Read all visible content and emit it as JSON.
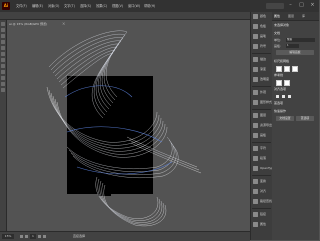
{
  "app": {
    "logo": "Ai"
  },
  "menu": [
    "文件(F)",
    "编辑(E)",
    "对象(O)",
    "文字(T)",
    "选择(S)",
    "效果(C)",
    "视图(V)",
    "窗口(W)",
    "帮助(H)"
  ],
  "document_tab": {
    "title": "ai @ 15% (RGB/GPU 预览)",
    "close": "×"
  },
  "status": {
    "zoom": "15%",
    "page": "1",
    "tool_text": "直接选择"
  },
  "panels": [
    {
      "label": "颜色",
      "icon": "color-icon"
    },
    {
      "label": "色板",
      "icon": "swatches-icon"
    },
    {
      "label": "画笔",
      "icon": "brushes-icon"
    },
    {
      "label": "符号",
      "icon": "symbols-icon"
    },
    {
      "label": "描边",
      "icon": "stroke-icon"
    },
    {
      "label": "渐变",
      "icon": "gradient-icon"
    },
    {
      "label": "透明度",
      "icon": "transparency-icon"
    },
    {
      "label": "外观",
      "icon": "appearance-icon"
    },
    {
      "label": "图形样式",
      "icon": "graphic-styles-icon"
    },
    {
      "label": "图层",
      "icon": "layers-icon"
    },
    {
      "label": "资源导出",
      "icon": "asset-export-icon"
    },
    {
      "label": "画板",
      "icon": "artboards-icon"
    },
    {
      "label": "字符",
      "icon": "character-icon"
    },
    {
      "label": "段落",
      "icon": "paragraph-icon"
    },
    {
      "label": "OpenType",
      "icon": "opentype-icon"
    },
    {
      "label": "变换",
      "icon": "transform-icon"
    },
    {
      "label": "对齐",
      "icon": "align-icon"
    },
    {
      "label": "路径查找器",
      "icon": "pathfinder-icon"
    },
    {
      "label": "链接",
      "icon": "links-icon"
    },
    {
      "label": "属性",
      "icon": "properties-icon"
    }
  ],
  "properties": {
    "tabs": [
      "属性",
      "图层",
      "库"
    ],
    "section_title": "未选择对象",
    "doc_label": "文档",
    "fields": {
      "units_label": "单位:",
      "units_value": "像素",
      "artboard_label": "画板:",
      "artboard_value": "1",
      "edit_artboard": "编辑画板"
    },
    "ruler_section": "标尺和网格",
    "guides_section": "参考线",
    "snap_section": "对齐选项",
    "prefs_section": "首选项",
    "quick_actions": "快速操作",
    "doc_setup_button": "文档设置",
    "prefs_button": "首选项"
  },
  "colors": {
    "bg_canvas": "#535353",
    "artboard": "#000000",
    "ribbon_white": "#e8ecf5",
    "ribbon_blue": "#5a7fd8"
  }
}
